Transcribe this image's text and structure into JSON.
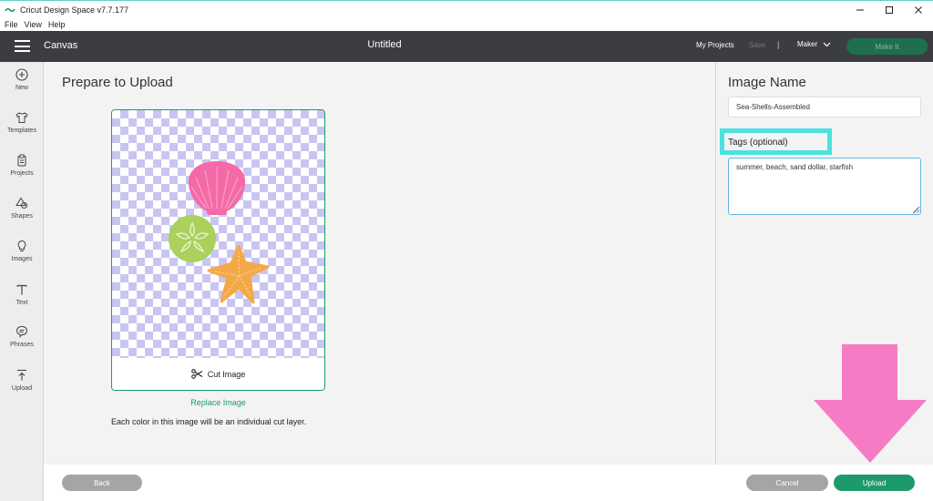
{
  "window": {
    "title": "Cricut Design Space  v7.7.177"
  },
  "menu": [
    "File",
    "View",
    "Help"
  ],
  "header": {
    "section": "Canvas",
    "doc_title": "Untitled",
    "my_projects": "My Projects",
    "save": "Save",
    "divider": "|",
    "machine": "Maker",
    "make_it": "Make It"
  },
  "nav": [
    {
      "label": "New",
      "icon": "plus-circle-icon"
    },
    {
      "label": "Templates",
      "icon": "shirt-icon"
    },
    {
      "label": "Projects",
      "icon": "clipboard-icon"
    },
    {
      "label": "Shapes",
      "icon": "shapes-icon"
    },
    {
      "label": "Images",
      "icon": "lightbulb-icon"
    },
    {
      "label": "Text",
      "icon": "text-t-icon"
    },
    {
      "label": "Phrases",
      "icon": "speech-bubble-icon"
    },
    {
      "label": "Upload",
      "icon": "upload-icon"
    }
  ],
  "main": {
    "title": "Prepare to Upload",
    "cut_image": "Cut Image",
    "replace_image": "Replace Image",
    "info": "Each color in this image will be an individual cut layer."
  },
  "right": {
    "heading": "Image Name",
    "image_name_value": "Sea-Shells-Assembled",
    "tags_label": "Tags (optional)",
    "tags_value": "summer, beach, sand dollar, starfish"
  },
  "footer": {
    "back": "Back",
    "cancel": "Cancel",
    "upload": "Upload"
  },
  "colors": {
    "accent_green": "#1d9a6c",
    "highlight_cyan": "#4ce2df",
    "arrow_pink": "#f57cc4",
    "shell_pink": "#f46aa6",
    "sand_dollar_green": "#a9d15b",
    "starfish_orange": "#f4a949"
  }
}
